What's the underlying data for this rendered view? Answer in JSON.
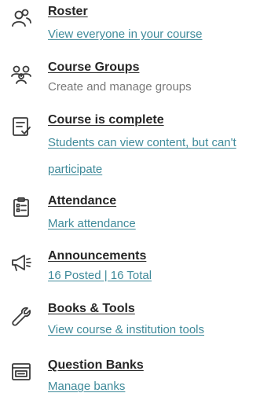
{
  "nav": {
    "roster": {
      "title": "Roster",
      "subtitle": "View everyone in your course",
      "icon": "users-icon"
    },
    "course_groups": {
      "title": "Course Groups",
      "subtitle": "Create and manage groups",
      "icon": "groups-icon"
    },
    "course_status": {
      "title": "Course is complete",
      "subtitle": "Students can view content, but can't participate",
      "icon": "course-status-icon"
    },
    "attendance": {
      "title": "Attendance",
      "subtitle": "Mark attendance",
      "icon": "attendance-icon"
    },
    "announcements": {
      "title": "Announcements",
      "subtitle": "16 Posted | 16 Total",
      "icon": "megaphone-icon"
    },
    "books_tools": {
      "title": "Books & Tools",
      "subtitle": "View course & institution tools",
      "icon": "wrench-icon"
    },
    "question_banks": {
      "title": "Question Banks",
      "subtitle": "Manage banks",
      "icon": "question-bank-icon"
    }
  },
  "colors": {
    "title": "#262626",
    "link": "#3f8a9a",
    "muted": "#7a7a7a",
    "icon": "#3a3a3a"
  }
}
